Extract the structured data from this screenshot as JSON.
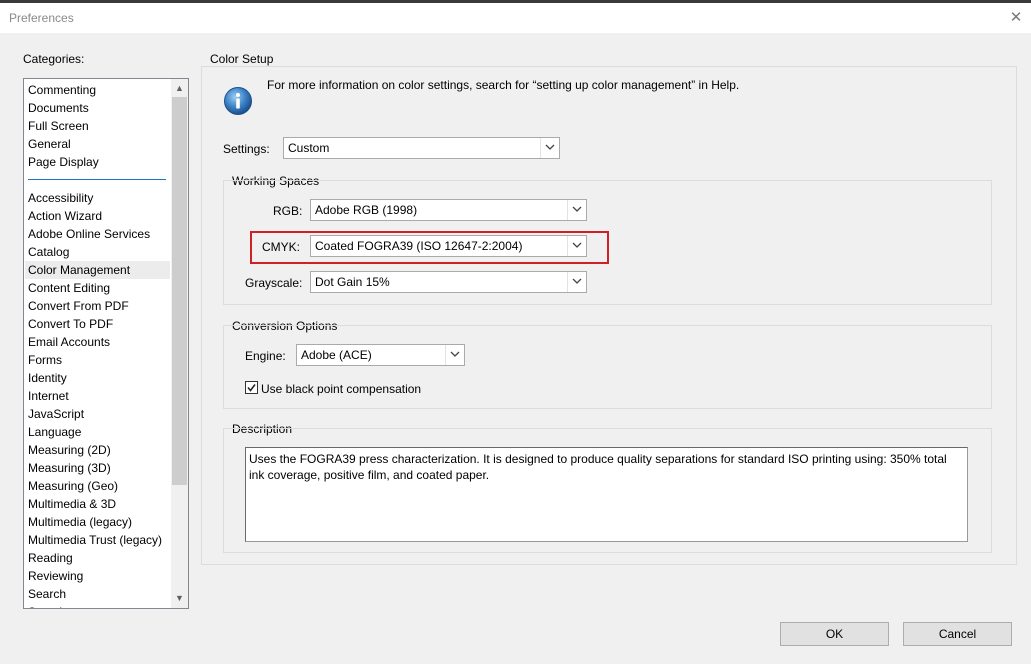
{
  "window": {
    "title": "Preferences",
    "close_glyph": "✕"
  },
  "categories": {
    "label": "Categories:",
    "group_top": [
      "Commenting",
      "Documents",
      "Full Screen",
      "General",
      "Page Display"
    ],
    "group_bottom": [
      "Accessibility",
      "Action Wizard",
      "Adobe Online Services",
      "Catalog",
      "Color Management",
      "Content Editing",
      "Convert From PDF",
      "Convert To PDF",
      "Email Accounts",
      "Forms",
      "Identity",
      "Internet",
      "JavaScript",
      "Language",
      "Measuring (2D)",
      "Measuring (3D)",
      "Measuring (Geo)",
      "Multimedia & 3D",
      "Multimedia (legacy)",
      "Multimedia Trust (legacy)",
      "Reading",
      "Reviewing",
      "Search",
      "Security"
    ],
    "selected": "Color Management"
  },
  "color_setup": {
    "label": "Color Setup",
    "info_text": "For more information on color settings, search for “setting up color management” in Help.",
    "info_icon": "info-icon",
    "settings_label": "Settings:",
    "settings_value": "Custom"
  },
  "working_spaces": {
    "label": "Working Spaces",
    "rgb_label": "RGB:",
    "rgb_value": "Adobe RGB (1998)",
    "cmyk_label": "CMYK:",
    "cmyk_value": "Coated FOGRA39 (ISO 12647-2:2004)",
    "grayscale_label": "Grayscale:",
    "grayscale_value": "Dot Gain 15%",
    "highlight_color": "#d21f26"
  },
  "conversion": {
    "label": "Conversion Options",
    "engine_label": "Engine:",
    "engine_value": "Adobe (ACE)",
    "bpc_label": "Use black point compensation",
    "bpc_checked": true
  },
  "description": {
    "label": "Description",
    "text": "Uses the FOGRA39 press characterization. It is designed to produce quality separations for standard ISO printing using: 350% total ink coverage, positive film, and coated paper."
  },
  "buttons": {
    "ok": "OK",
    "cancel": "Cancel"
  }
}
